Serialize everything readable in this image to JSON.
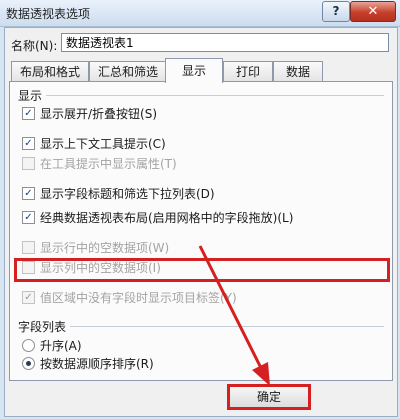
{
  "window": {
    "title": "数据透视表选项",
    "help_label": "?",
    "close_label": "✕"
  },
  "name_field": {
    "label": "名称(N):",
    "value": "数据透视表1"
  },
  "tabs": [
    {
      "label": "布局和格式"
    },
    {
      "label": "汇总和筛选"
    },
    {
      "label": "显示"
    },
    {
      "label": "打印"
    },
    {
      "label": "数据"
    }
  ],
  "active_tab": "显示",
  "display_section": {
    "title": "显示",
    "options": [
      {
        "label": "显示展开/折叠按钮(S)",
        "checked": true,
        "enabled": true
      },
      {
        "label": "显示上下文工具提示(C)",
        "checked": true,
        "enabled": true
      },
      {
        "label": "在工具提示中显示属性(T)",
        "checked": false,
        "enabled": false
      },
      {
        "label": "显示字段标题和筛选下拉列表(D)",
        "checked": true,
        "enabled": true
      },
      {
        "label": "经典数据透视表布局(启用网格中的字段拖放)(L)",
        "checked": true,
        "enabled": true
      },
      {
        "label": "显示行中的空数据项(W)",
        "checked": false,
        "enabled": false
      },
      {
        "label": "显示列中的空数据项(I)",
        "checked": false,
        "enabled": false
      },
      {
        "label": "值区域中没有字段时显示项目标签(Y)",
        "checked": true,
        "enabled": false
      }
    ]
  },
  "field_list_section": {
    "title": "字段列表",
    "options": [
      {
        "label": "升序(A)",
        "selected": false
      },
      {
        "label": "按数据源顺序排序(R)",
        "selected": true
      }
    ]
  },
  "buttons": {
    "ok_label": "确定"
  },
  "colors": {
    "highlight": "#d42020",
    "title_bar": "#cddcee",
    "panel": "#fbfbfb"
  }
}
